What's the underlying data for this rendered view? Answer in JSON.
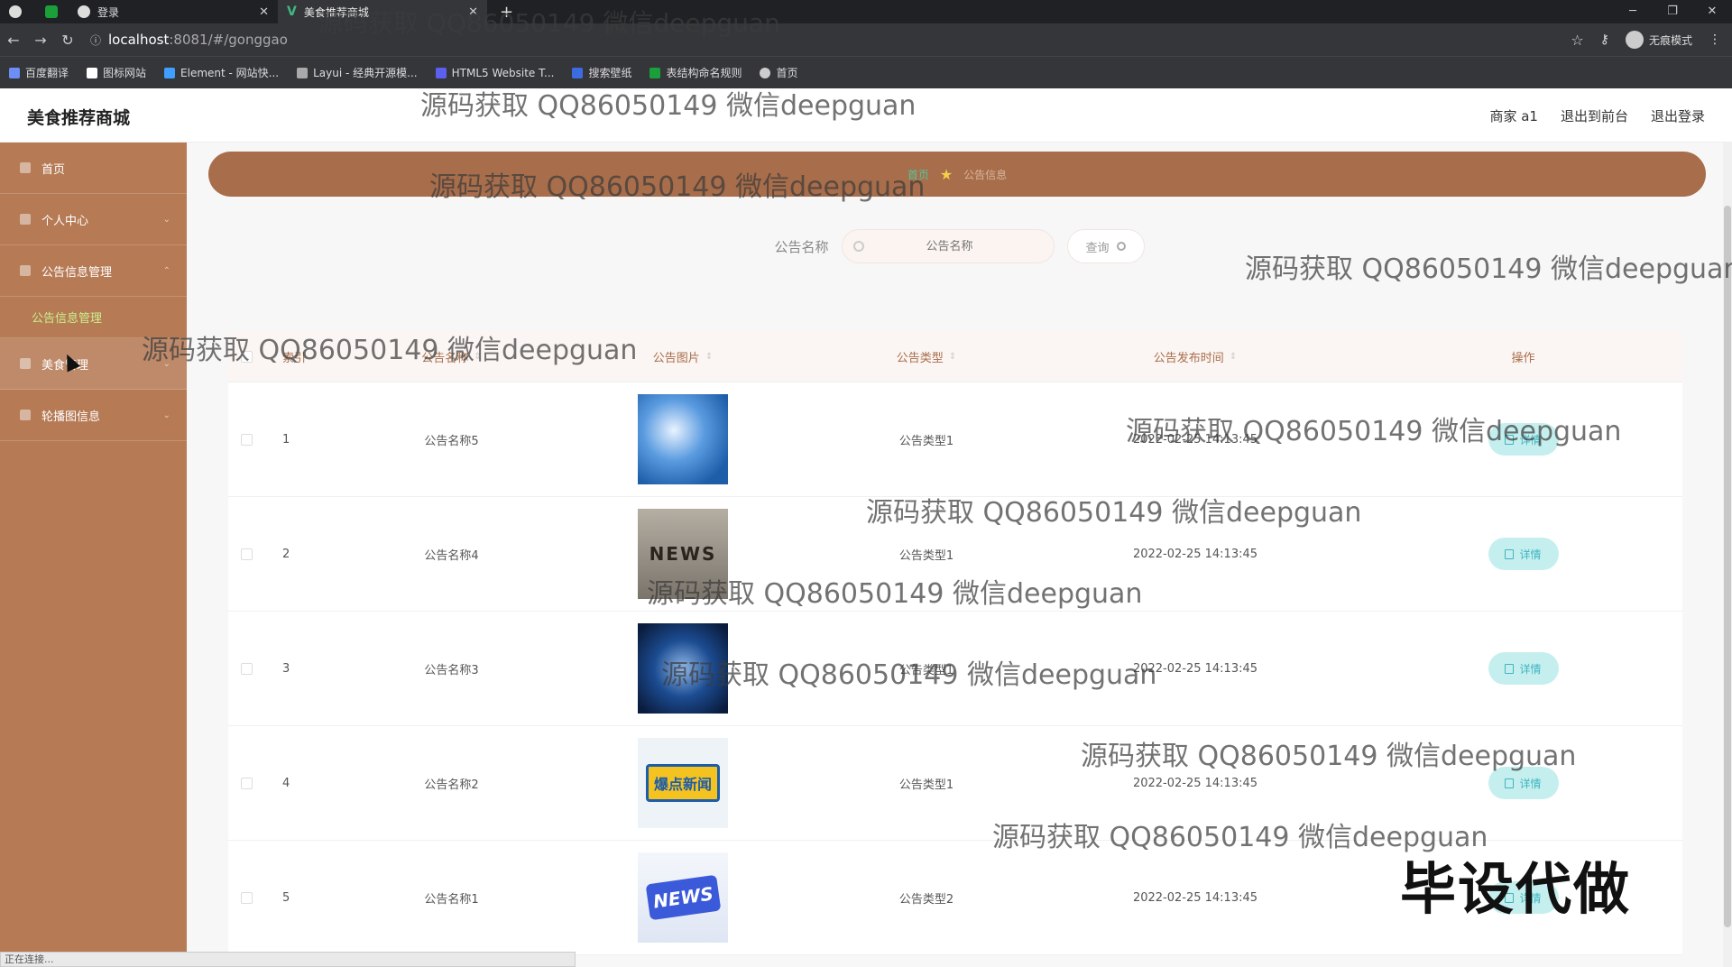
{
  "browser": {
    "tabs": [
      {
        "title": ""
      },
      {
        "title": ""
      },
      {
        "title": "登录"
      },
      {
        "title": "美食推荐商城"
      }
    ],
    "url_host": "localhost",
    "url_path": ":8081/#/gonggao",
    "incognito_label": "无痕模式",
    "bookmarks": [
      "百度翻译",
      "图标网站",
      "Element - 网站快...",
      "Layui - 经典开源模...",
      "HTML5 Website T...",
      "搜索壁纸",
      "表结构命名规则",
      "首页"
    ],
    "status_text": "正在连接..."
  },
  "header": {
    "app_title": "美食推荐商城",
    "user": "商家 a1",
    "back_to_front": "退出到前台",
    "logout": "退出登录"
  },
  "sidebar": {
    "items": [
      {
        "label": "首页"
      },
      {
        "label": "个人中心"
      },
      {
        "label": "公告信息管理"
      },
      {
        "label": "公告信息管理"
      },
      {
        "label": "美食管理"
      },
      {
        "label": "轮播图信息"
      }
    ]
  },
  "breadcrumb": {
    "home": "首页",
    "current": "公告信息"
  },
  "search": {
    "label": "公告名称",
    "placeholder": "公告名称",
    "button": "查询"
  },
  "table": {
    "columns": [
      "索引",
      "公告名称",
      "公告图片",
      "公告类型",
      "公告发布时间",
      "操作"
    ],
    "detail_label": "详情",
    "rows": [
      {
        "index": "1",
        "name": "公告名称5",
        "type": "公告类型1",
        "time": "2022-02-25 14:13:45"
      },
      {
        "index": "2",
        "name": "公告名称4",
        "type": "公告类型1",
        "time": "2022-02-25 14:13:45"
      },
      {
        "index": "3",
        "name": "公告名称3",
        "type": "公告类型1",
        "time": "2022-02-25 14:13:45"
      },
      {
        "index": "4",
        "name": "公告名称2",
        "type": "公告类型1",
        "time": "2022-02-25 14:13:45"
      },
      {
        "index": "5",
        "name": "公告名称1",
        "type": "公告类型2",
        "time": "2022-02-25 14:13:45"
      }
    ],
    "thumb_texts": [
      "NEWS",
      "爆点新闻",
      "NEWS"
    ]
  },
  "overlay": {
    "watermark": "源码获取 QQ86050149 微信deepguan",
    "stamp": "毕设代做"
  }
}
